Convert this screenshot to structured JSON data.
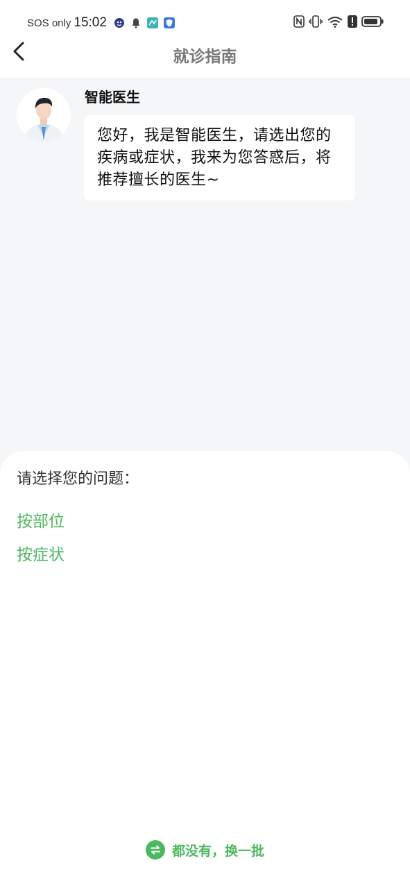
{
  "status_bar": {
    "carrier": "SOS only",
    "time": "15:02"
  },
  "header": {
    "title": "就诊指南"
  },
  "chat": {
    "doctor_name": "智能医生",
    "message": "您好，我是智能医生，请选出您的疾病或症状，我来为您答惑后，将推荐擅长的医生~"
  },
  "question": {
    "prompt": "请选择您的问题：",
    "options": [
      {
        "label": "按部位"
      },
      {
        "label": "按症状"
      }
    ],
    "refresh_label": "都没有，换一批"
  },
  "colors": {
    "accent": "#4cb860",
    "background": "#f5f6f8"
  }
}
